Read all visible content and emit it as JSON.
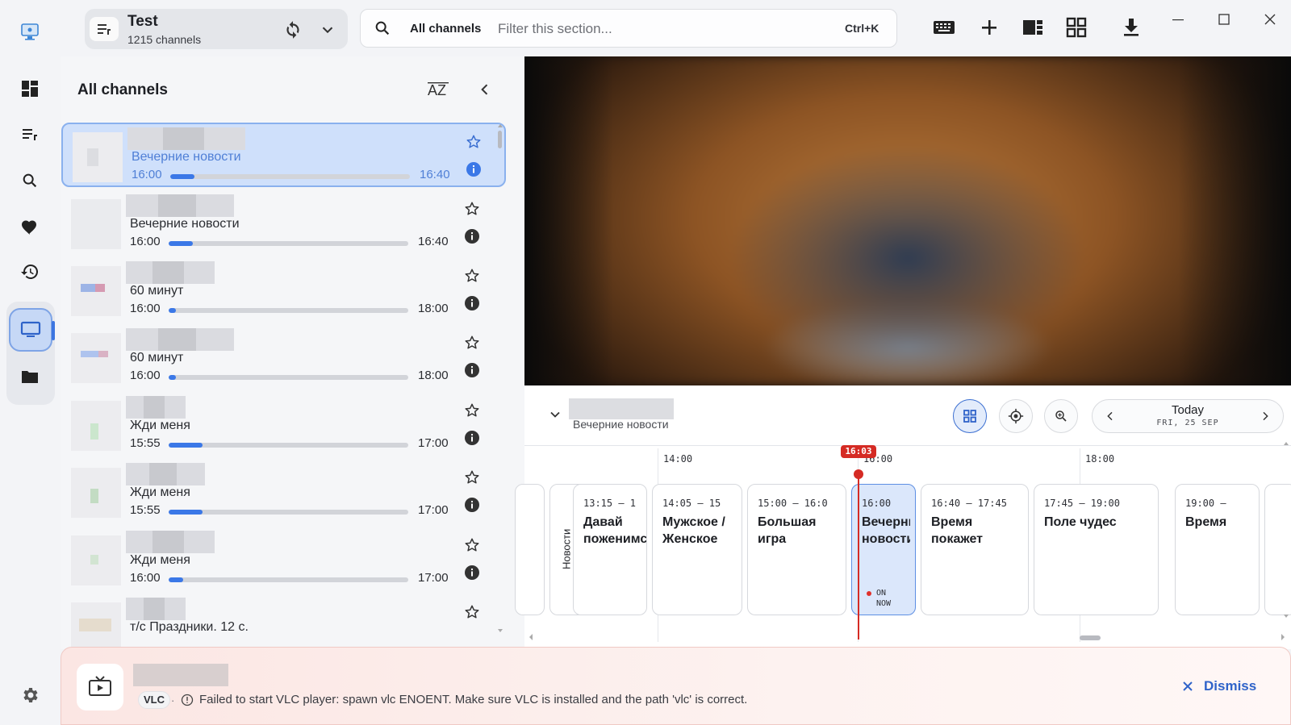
{
  "playlist": {
    "title": "Test",
    "count": "1215 channels"
  },
  "search": {
    "scope": "All channels",
    "placeholder": "Filter this section...",
    "shortcut": "Ctrl+K"
  },
  "toolbar": {
    "icons": [
      "keyboard-icon",
      "add-icon",
      "layout-icon",
      "grid-icon",
      "download-icon"
    ]
  },
  "window": {
    "icons": [
      "minimize-icon",
      "maximize-icon",
      "close-icon"
    ]
  },
  "rail": {
    "items": [
      "dashboard-icon",
      "playlist-icon",
      "search-icon",
      "favorites-icon",
      "history-icon",
      "tv-icon",
      "folder-icon",
      "settings-icon"
    ],
    "active": "tv-icon"
  },
  "panel": {
    "title": "All channels",
    "sort_label": "AZ"
  },
  "channels": [
    {
      "program": "Вечерние новости",
      "start": "16:00",
      "end": "16:40",
      "progress": 0.1,
      "selected": true
    },
    {
      "program": "Вечерние новости",
      "start": "16:00",
      "end": "16:40",
      "progress": 0.1,
      "selected": false
    },
    {
      "program": "60 минут",
      "start": "16:00",
      "end": "18:00",
      "progress": 0.03,
      "selected": false
    },
    {
      "program": "60 минут",
      "start": "16:00",
      "end": "18:00",
      "progress": 0.03,
      "selected": false
    },
    {
      "program": "Жди меня",
      "start": "15:55",
      "end": "17:00",
      "progress": 0.14,
      "selected": false
    },
    {
      "program": "Жди меня",
      "start": "15:55",
      "end": "17:00",
      "progress": 0.14,
      "selected": false
    },
    {
      "program": "Жди меня",
      "start": "16:00",
      "end": "17:00",
      "progress": 0.06,
      "selected": false
    },
    {
      "program": "т/с Праздники. 12 с.",
      "start": "",
      "end": "",
      "progress": 0,
      "selected": false
    }
  ],
  "epg": {
    "channel_program": "Вечерние новости",
    "date_main": "Today",
    "date_sub": "FRI, 25 SEP",
    "now_time": "16:03",
    "time_labels": [
      "14:00",
      "16:00",
      "18:00"
    ],
    "programs": [
      {
        "time": "",
        "title": "Новости",
        "vertical": true
      },
      {
        "time": "13:15 – 1",
        "title": "Давай поженимся!"
      },
      {
        "time": "14:05 – 15",
        "title": "Мужское / Женское"
      },
      {
        "time": "15:00 – 16:0",
        "title": "Большая игра"
      },
      {
        "time": "16:00",
        "title": "Вечерние новости",
        "now": true,
        "now_label": "ON NOW"
      },
      {
        "time": "16:40 – 17:45",
        "title": "Время покажет"
      },
      {
        "time": "17:45 – 19:00",
        "title": "Поле чудес"
      },
      {
        "time": "19:00 –",
        "title": "Время"
      }
    ]
  },
  "toast": {
    "chip": "VLC",
    "message": "Failed to start VLC player: spawn vlc ENOENT. Make sure VLC is installed and the path 'vlc' is correct.",
    "dismiss": "Dismiss"
  }
}
